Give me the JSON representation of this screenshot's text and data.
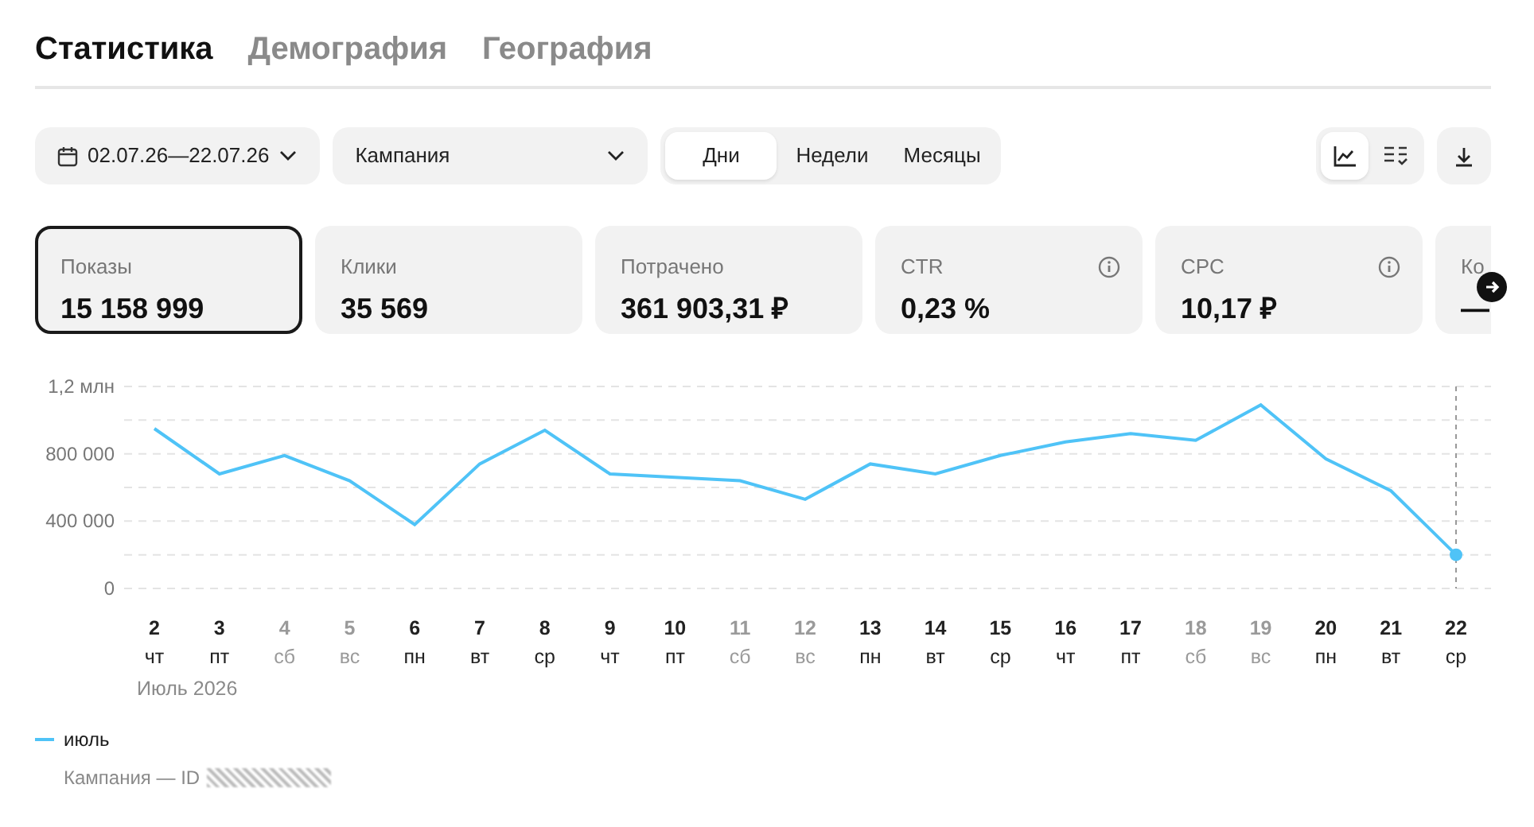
{
  "tabs": [
    {
      "label": "Статистика",
      "selected": true
    },
    {
      "label": "Демография",
      "selected": false
    },
    {
      "label": "География",
      "selected": false
    }
  ],
  "toolbar": {
    "date_range": "02.07.26—22.07.26",
    "campaign_select": "Кампания",
    "periods": [
      {
        "label": "Дни",
        "selected": true
      },
      {
        "label": "Недели",
        "selected": false
      },
      {
        "label": "Месяцы",
        "selected": false
      }
    ],
    "views": [
      {
        "kind": "chart",
        "selected": true
      },
      {
        "kind": "table",
        "selected": false
      }
    ]
  },
  "metrics": [
    {
      "label": "Показы",
      "value": "15 158 999",
      "selected": true,
      "info": false
    },
    {
      "label": "Клики",
      "value": "35 569",
      "selected": false,
      "info": false
    },
    {
      "label": "Потрачено",
      "value": "361 903,31 ₽",
      "selected": false,
      "info": false
    },
    {
      "label": "CTR",
      "value": "0,23 %",
      "selected": false,
      "info": true
    },
    {
      "label": "CPC",
      "value": "10,17 ₽",
      "selected": false,
      "info": true
    },
    {
      "label": "Ко",
      "value": "—",
      "selected": false,
      "info": false
    }
  ],
  "chart": {
    "chart_data": {
      "type": "line",
      "categories": [
        "2",
        "3",
        "4",
        "5",
        "6",
        "7",
        "8",
        "9",
        "10",
        "11",
        "12",
        "13",
        "14",
        "15",
        "16",
        "17",
        "18",
        "19",
        "20",
        "21",
        "22"
      ],
      "series": [
        {
          "name": "июль",
          "color": "#4fc3f7",
          "values": [
            950000,
            680000,
            790000,
            640000,
            380000,
            740000,
            940000,
            680000,
            660000,
            640000,
            530000,
            740000,
            680000,
            790000,
            870000,
            920000,
            880000,
            1090000,
            770000,
            580000,
            200000
          ]
        }
      ],
      "ylim": [
        0,
        1200000
      ],
      "yticks": [
        {
          "value": 0,
          "label": "0"
        },
        {
          "value": 400000,
          "label": "400 000"
        },
        {
          "value": 800000,
          "label": "800 000"
        }
      ],
      "ref_lines": [
        {
          "axis": "x",
          "value": "22"
        }
      ]
    },
    "weekdays": [
      {
        "label": "чт",
        "weekend": false
      },
      {
        "label": "пт",
        "weekend": false
      },
      {
        "label": "сб",
        "weekend": true
      },
      {
        "label": "вс",
        "weekend": true
      },
      {
        "label": "пн",
        "weekend": false
      },
      {
        "label": "вт",
        "weekend": false
      },
      {
        "label": "ср",
        "weekend": false
      },
      {
        "label": "чт",
        "weekend": false
      },
      {
        "label": "пт",
        "weekend": false
      },
      {
        "label": "сб",
        "weekend": true
      },
      {
        "label": "вс",
        "weekend": true
      },
      {
        "label": "пн",
        "weekend": false
      },
      {
        "label": "вт",
        "weekend": false
      },
      {
        "label": "ср",
        "weekend": false
      },
      {
        "label": "чт",
        "weekend": false
      },
      {
        "label": "пт",
        "weekend": false
      },
      {
        "label": "сб",
        "weekend": true
      },
      {
        "label": "вс",
        "weekend": true
      },
      {
        "label": "пн",
        "weekend": false
      },
      {
        "label": "вт",
        "weekend": false
      },
      {
        "label": "ср",
        "weekend": false
      }
    ],
    "y_axis_top_label": "1,2 млн",
    "month_label": "Июль 2026"
  },
  "legend": {
    "caption": "Кампания — ID"
  }
}
